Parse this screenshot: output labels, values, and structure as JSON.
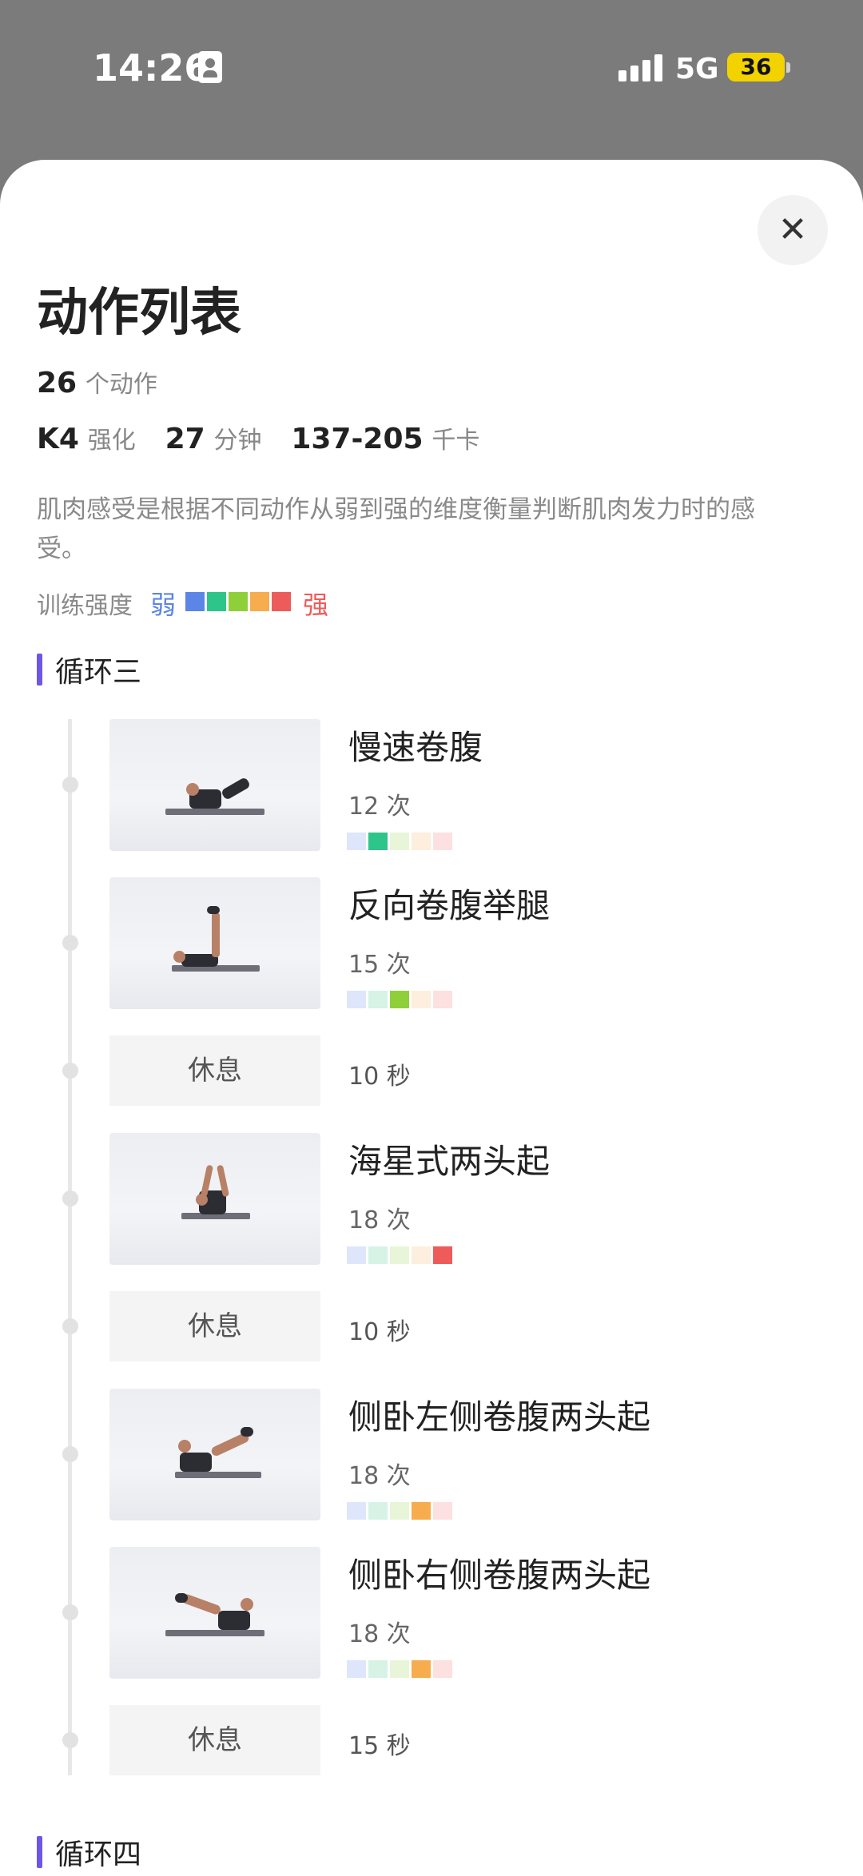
{
  "status": {
    "time": "14:26",
    "network": "5G",
    "battery": "36"
  },
  "sheet": {
    "close_glyph": "✕",
    "title": "动作列表",
    "count_value": "26",
    "count_unit": "个动作",
    "level": "K4",
    "level_label": "强化",
    "duration_value": "27",
    "duration_unit": "分钟",
    "calories_value": "137-205",
    "calories_unit": "千卡",
    "description": "肌肉感受是根据不同动作从弱到强的维度衡量判断肌肉发力时的感受。",
    "intensity_label": "训练强度",
    "intensity_weak": "弱",
    "intensity_strong": "强"
  },
  "colors": {
    "level_full": [
      "#5b85e6",
      "#2ec58a",
      "#8fcf3a",
      "#f7ac4e",
      "#ee5b5b"
    ],
    "level_light": [
      "#dde6fb",
      "#d6f3e6",
      "#e8f5d8",
      "#fdeedd",
      "#fde0e0"
    ],
    "section_bar": "#6e56e8"
  },
  "sections": [
    {
      "title": "循环三",
      "items": [
        {
          "type": "exercise",
          "name": "慢速卷腹",
          "count": "12 次",
          "intensity": 2,
          "pose": "crunch"
        },
        {
          "type": "exercise",
          "name": "反向卷腹举腿",
          "count": "15 次",
          "intensity": 3,
          "pose": "legs-up"
        },
        {
          "type": "rest",
          "label": "休息",
          "time": "10 秒"
        },
        {
          "type": "exercise",
          "name": "海星式两头起",
          "count": "18 次",
          "intensity": 5,
          "pose": "v-up"
        },
        {
          "type": "rest",
          "label": "休息",
          "time": "10 秒"
        },
        {
          "type": "exercise",
          "name": "侧卧左侧卷腹两头起",
          "count": "18 次",
          "intensity": 4,
          "pose": "side-left"
        },
        {
          "type": "exercise",
          "name": "侧卧右侧卷腹两头起",
          "count": "18 次",
          "intensity": 4,
          "pose": "side-right"
        },
        {
          "type": "rest",
          "label": "休息",
          "time": "15 秒"
        }
      ]
    },
    {
      "title": "循环四",
      "items": []
    }
  ]
}
